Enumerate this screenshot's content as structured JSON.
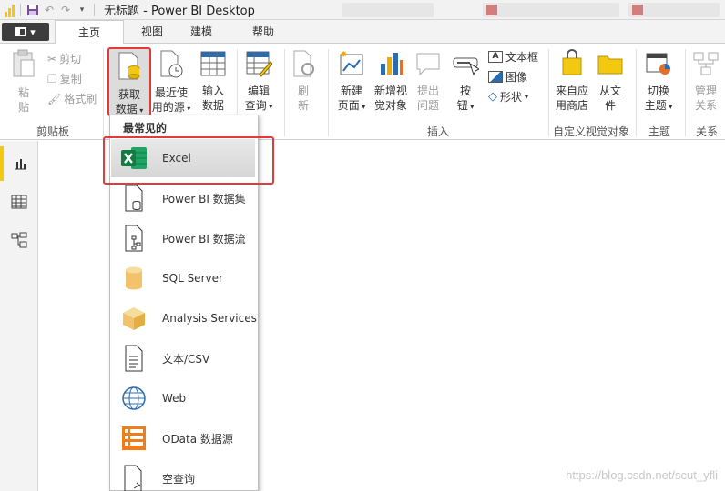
{
  "title_bar": {
    "title": "无标题 - Power BI Desktop"
  },
  "tabs": {
    "file": "",
    "home": "主页",
    "view": "视图",
    "modeling": "建模",
    "help": "帮助"
  },
  "ribbon": {
    "clipboard": {
      "paste": [
        "粘",
        "贴"
      ],
      "cut": "剪切",
      "copy": "复制",
      "format_painter": "格式刷",
      "group_label": "剪贴板"
    },
    "data": {
      "get_data": [
        "获取",
        "数据"
      ],
      "recent_sources": [
        "最近使",
        "用的源"
      ],
      "enter_data": [
        "输入",
        "数据"
      ],
      "edit_queries": [
        "编辑",
        "查询"
      ],
      "refresh": [
        "刷",
        "新"
      ]
    },
    "insert": {
      "new_page": [
        "新建",
        "页面"
      ],
      "new_visual": [
        "新增视",
        "觉对象"
      ],
      "ask_question": [
        "提出",
        "问题"
      ],
      "buttons": [
        "按",
        "钮"
      ],
      "text_box": "文本框",
      "image": "图像",
      "shapes": "形状",
      "group_label": "插入"
    },
    "custom_visuals": {
      "from_store": [
        "来自应",
        "用商店"
      ],
      "from_file": [
        "从文",
        "件"
      ],
      "group_label": "自定义视觉对象"
    },
    "themes": {
      "switch_theme": [
        "切换",
        "主题"
      ],
      "group_label": "主题"
    },
    "relationships": {
      "manage": [
        "管理",
        "关系"
      ],
      "group_label": "关系"
    }
  },
  "dropdown": {
    "header": "最常见的",
    "items": [
      {
        "label": "Excel",
        "icon": "excel-icon"
      },
      {
        "label": "Power BI 数据集",
        "icon": "dataset-icon"
      },
      {
        "label": "Power BI 数据流",
        "icon": "dataflow-icon"
      },
      {
        "label": "SQL Server",
        "icon": "database-icon"
      },
      {
        "label": "Analysis Services",
        "icon": "cube-icon"
      },
      {
        "label": "文本/CSV",
        "icon": "text-file-icon"
      },
      {
        "label": "Web",
        "icon": "globe-icon"
      },
      {
        "label": "OData 数据源",
        "icon": "odata-icon"
      },
      {
        "label": "空查询",
        "icon": "blank-query-icon"
      }
    ]
  },
  "watermark": "https://blog.csdn.net/scut_yfli",
  "colors": {
    "accent_yellow": "#f2c811",
    "highlight_red": "#e23a3a",
    "excel_green": "#1e7145"
  }
}
